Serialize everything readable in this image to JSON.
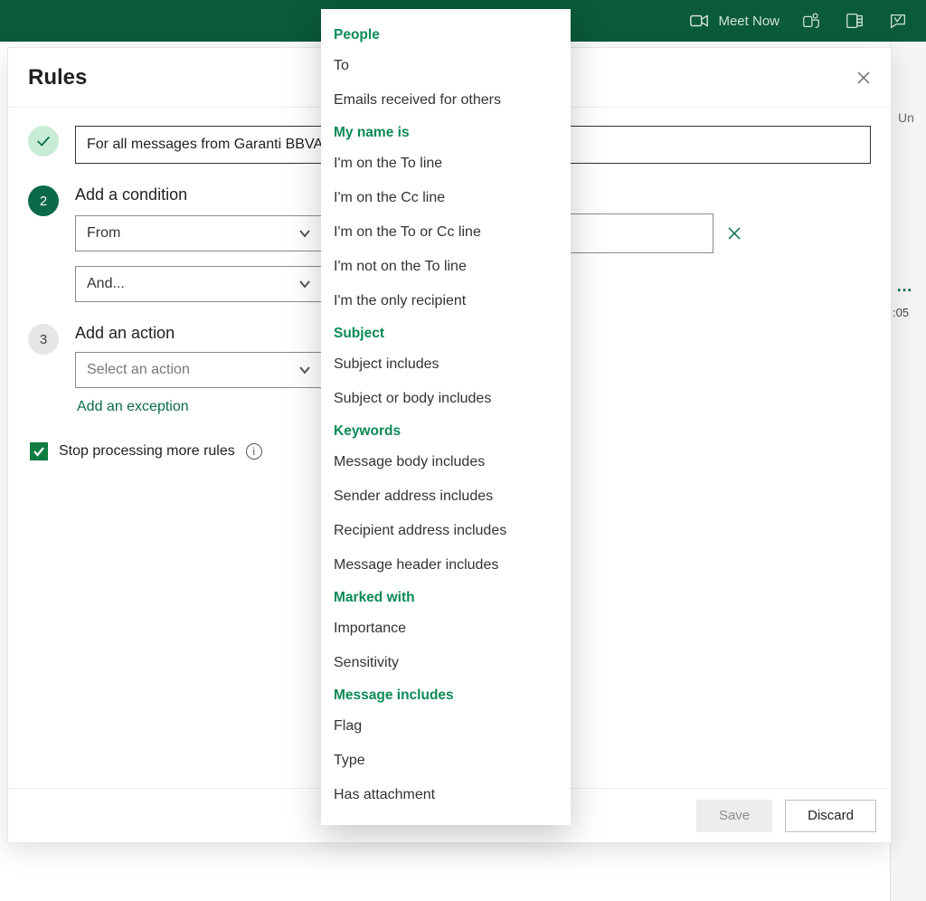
{
  "topbar": {
    "meet_now": "Meet Now"
  },
  "right_strip": {
    "un": "Un",
    "time": ":05"
  },
  "modal": {
    "title": "Rules",
    "rule_name_value": "For all messages from Garanti BBVA",
    "step2_label": "Add a condition",
    "step3_label": "Add an action",
    "from_select": "From",
    "and_select": "And...",
    "action_placeholder": "Select an action",
    "add_exception": "Add an exception",
    "stop_processing": "Stop processing more rules",
    "save": "Save",
    "discard": "Discard",
    "step2_number": "2",
    "step3_number": "3"
  },
  "dropdown": {
    "groups": [
      {
        "header": "People",
        "items": [
          "To",
          "Emails received for others"
        ]
      },
      {
        "header": "My name is",
        "items": [
          "I'm on the To line",
          "I'm on the Cc line",
          "I'm on the To or Cc line",
          "I'm not on the To line",
          "I'm the only recipient"
        ]
      },
      {
        "header": "Subject",
        "items": [
          "Subject includes",
          "Subject or body includes"
        ]
      },
      {
        "header": "Keywords",
        "items": [
          "Message body includes",
          "Sender address includes",
          "Recipient address includes",
          "Message header includes"
        ]
      },
      {
        "header": "Marked with",
        "items": [
          "Importance",
          "Sensitivity"
        ]
      },
      {
        "header": "Message includes",
        "items": [
          "Flag",
          "Type",
          "Has attachment"
        ]
      }
    ]
  }
}
